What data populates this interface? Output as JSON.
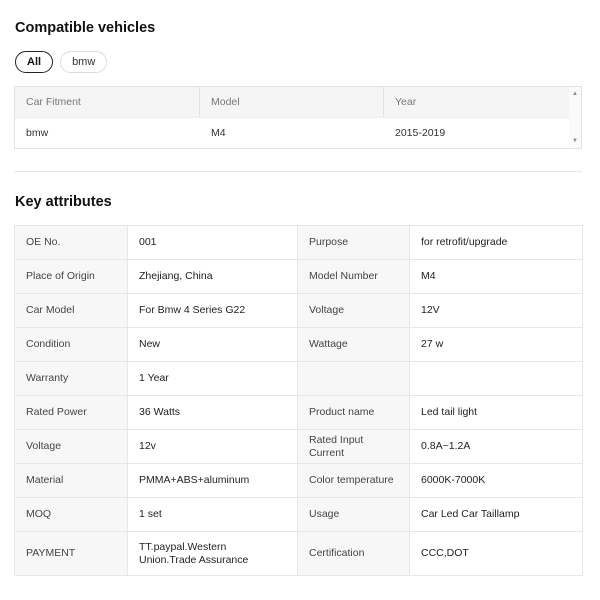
{
  "compatible": {
    "title": "Compatible vehicles",
    "chips": [
      {
        "label": "All",
        "active": true
      },
      {
        "label": "bmw",
        "active": false
      }
    ],
    "table": {
      "headers": [
        "Car Fitment",
        "Model",
        "Year"
      ],
      "rows": [
        [
          "bmw",
          "M4",
          "2015-2019"
        ]
      ]
    }
  },
  "attributes": {
    "title": "Key attributes",
    "rows": [
      [
        {
          "k": "OE No.",
          "v": "001"
        },
        {
          "k": "Purpose",
          "v": "for retrofit/upgrade"
        }
      ],
      [
        {
          "k": "Place of Origin",
          "v": "Zhejiang, China"
        },
        {
          "k": "Model Number",
          "v": "M4"
        }
      ],
      [
        {
          "k": "Car Model",
          "v": "For Bmw 4 Series G22"
        },
        {
          "k": "Voltage",
          "v": "12V"
        }
      ],
      [
        {
          "k": "Condition",
          "v": "New"
        },
        {
          "k": "Wattage",
          "v": "27 w"
        }
      ],
      [
        {
          "k": "Warranty",
          "v": "1 Year"
        },
        {
          "k": "",
          "v": ""
        }
      ],
      [
        {
          "k": "Rated Power",
          "v": "36 Watts"
        },
        {
          "k": "Product name",
          "v": "Led tail light"
        }
      ],
      [
        {
          "k": "Voltage",
          "v": "12v"
        },
        {
          "k": "Rated Input Current",
          "v": "0.8A~1.2A"
        }
      ],
      [
        {
          "k": "Material",
          "v": "PMMA+ABS+aluminum"
        },
        {
          "k": "Color temperature",
          "v": "6000K-7000K"
        }
      ],
      [
        {
          "k": "MOQ",
          "v": "1 set"
        },
        {
          "k": "Usage",
          "v": "Car Led Car Taillamp"
        }
      ],
      [
        {
          "k": "PAYMENT",
          "v": "TT.paypal.Western Union.Trade Assurance"
        },
        {
          "k": "Certification",
          "v": "CCC,DOT"
        }
      ]
    ]
  }
}
